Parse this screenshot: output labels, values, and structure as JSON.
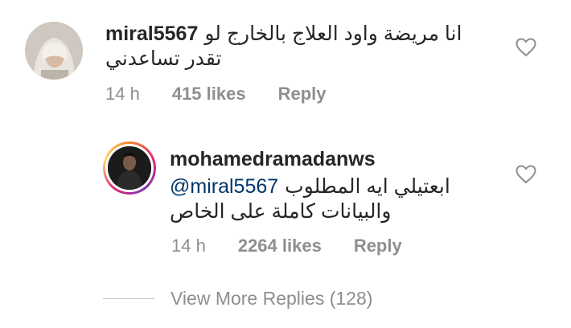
{
  "comments": [
    {
      "username": "miral5567",
      "text_line1": "انا مريضة واود العلاج بالخارج لو",
      "text_line2": "تقدر تساعدني",
      "time": "14 h",
      "likes": "415 likes",
      "reply_label": "Reply",
      "avatar_icon": "avatar-photo"
    },
    {
      "username": "mohamedramadanws",
      "mention": "@miral5567",
      "text_line1_rest": "ابعتيلي ايه المطلوب",
      "text_line2": "والبيانات كاملة على الخاص",
      "time": "14 h",
      "likes": "2264 likes",
      "reply_label": "Reply",
      "avatar_icon": "avatar-photo-story-ring"
    }
  ],
  "view_more": "View More Replies (128)",
  "colors": {
    "text": "#262626",
    "muted": "#8e8e8e",
    "mention": "#003569"
  }
}
